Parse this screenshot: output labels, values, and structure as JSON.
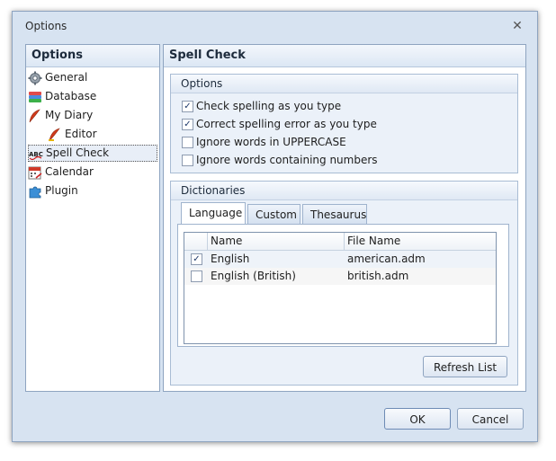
{
  "window": {
    "title": "Options",
    "close_glyph": "✕"
  },
  "sidebar": {
    "title": "Options",
    "items": [
      {
        "label": "General",
        "icon": "gear-icon"
      },
      {
        "label": "Database",
        "icon": "database-icon"
      },
      {
        "label": "My Diary",
        "icon": "feather-icon"
      },
      {
        "label": "Editor",
        "icon": "feather-icon"
      },
      {
        "label": "Spell Check",
        "icon": "abc-icon"
      },
      {
        "label": "Calendar",
        "icon": "calendar-icon"
      },
      {
        "label": "Plugin",
        "icon": "puzzle-icon"
      }
    ],
    "selected": "Spell Check"
  },
  "main": {
    "title": "Spell Check",
    "options_group": {
      "title": "Options",
      "checks": [
        {
          "label": "Check spelling as you type",
          "checked": true
        },
        {
          "label": "Correct spelling error as you type",
          "checked": true
        },
        {
          "label": "Ignore words in UPPERCASE",
          "checked": false
        },
        {
          "label": "Ignore words containing numbers",
          "checked": false
        }
      ]
    },
    "dictionaries_group": {
      "title": "Dictionaries",
      "tabs": [
        "Language",
        "Custom",
        "Thesaurus"
      ],
      "active_tab": "Language",
      "columns": [
        "Name",
        "File Name"
      ],
      "rows": [
        {
          "name": "English",
          "file": "american.adm",
          "checked": true
        },
        {
          "name": "English (British)",
          "file": "british.adm",
          "checked": false
        }
      ],
      "refresh_label": "Refresh List"
    }
  },
  "footer": {
    "ok_label": "OK",
    "cancel_label": "Cancel"
  },
  "colors": {
    "accent": "#8ea4c0",
    "background": "#d7e3f1"
  }
}
